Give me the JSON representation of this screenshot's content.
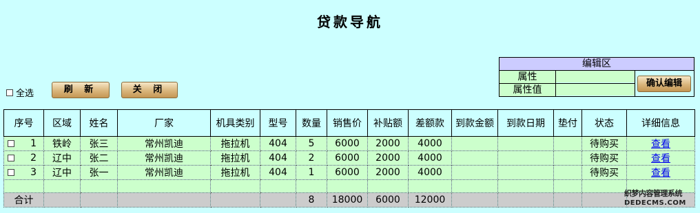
{
  "page": {
    "title": "贷款导航"
  },
  "toolbar": {
    "select_all_label": "全选",
    "refresh_label": "刷 新",
    "close_label": "关 闭"
  },
  "edit_panel": {
    "title": "编辑区",
    "attr_label": "属性",
    "attr_value_label": "属性值",
    "attr_value": "",
    "attr_value2": "",
    "confirm_label": "确认编辑"
  },
  "table": {
    "headers": [
      "序号",
      "区域",
      "姓名",
      "厂家",
      "机具类别",
      "型号",
      "数量",
      "销售价",
      "补贴额",
      "差额款",
      "到款金额",
      "到款日期",
      "垫付",
      "状态",
      "详细信息"
    ],
    "rows": [
      {
        "no": "1",
        "region": "铁岭",
        "name": "张三",
        "maker": "常州凯迪",
        "type": "拖拉机",
        "model": "404",
        "qty": "5",
        "price": "6000",
        "subsidy": "2000",
        "diff": "4000",
        "paid_amount": "",
        "paid_date": "",
        "advance": "",
        "status": "待购买",
        "detail": "查看"
      },
      {
        "no": "2",
        "region": "辽中",
        "name": "张二",
        "maker": "常州凯迪",
        "type": "拖拉机",
        "model": "404",
        "qty": "2",
        "price": "6000",
        "subsidy": "2000",
        "diff": "4000",
        "paid_amount": "",
        "paid_date": "",
        "advance": "",
        "status": "待购买",
        "detail": "查看"
      },
      {
        "no": "3",
        "region": "辽中",
        "name": "张一",
        "maker": "常州凯迪",
        "type": "拖拉机",
        "model": "404",
        "qty": "1",
        "price": "6000",
        "subsidy": "2000",
        "diff": "4000",
        "paid_amount": "",
        "paid_date": "",
        "advance": "",
        "status": "待购买",
        "detail": "查看"
      }
    ],
    "total": {
      "label": "合计",
      "qty": "8",
      "price": "18000",
      "subsidy": "6000",
      "diff": "12000"
    }
  },
  "watermark": {
    "line1": "织梦内容管理系统",
    "line2": "DEDECMS.COM"
  }
}
